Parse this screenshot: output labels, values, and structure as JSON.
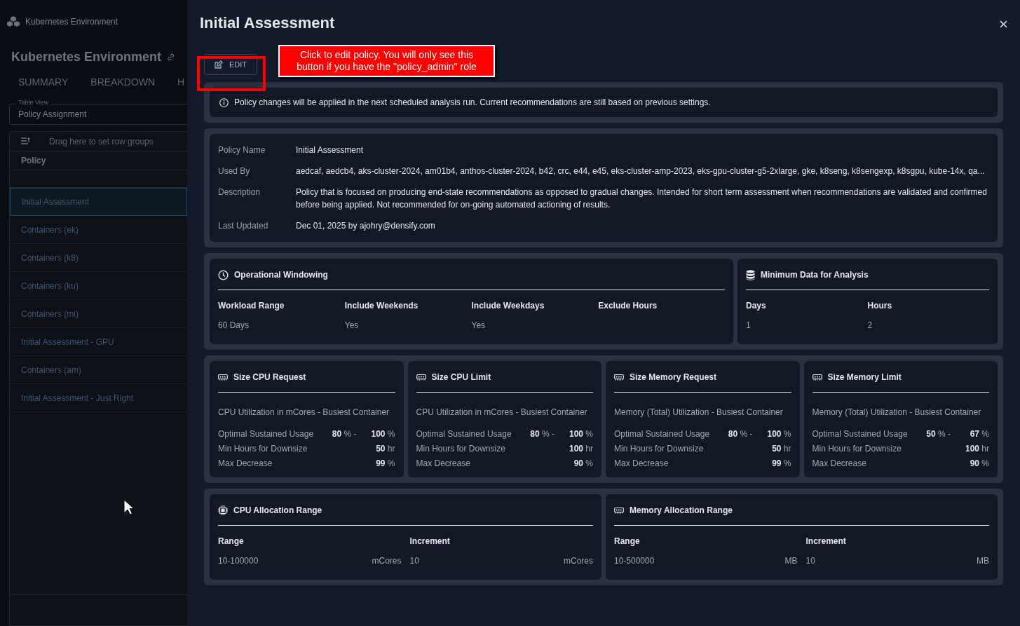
{
  "background_page": {
    "app_title": "Kubernetes Environment",
    "heading": "Kubernetes Environment",
    "tabs": [
      {
        "label": "SUMMARY",
        "selected": false
      },
      {
        "label": "BREAKDOWN",
        "selected": false
      },
      {
        "label": "H",
        "selected": false
      }
    ],
    "table_view": {
      "label": "Table View",
      "value": "Policy Assignment"
    },
    "group_hint": "Drag here to set row groups",
    "column": "Policy",
    "rows": [
      {
        "label": "Initial Assessment",
        "selected": true
      },
      {
        "label": "Containers (ek)",
        "selected": false
      },
      {
        "label": "Containers (k8)",
        "selected": false
      },
      {
        "label": "Containers (ku)",
        "selected": false
      },
      {
        "label": "Containers (mi)",
        "selected": false
      },
      {
        "label": "Initial Assessment - GPU",
        "selected": false
      },
      {
        "label": "Containers (am)",
        "selected": false
      },
      {
        "label": "Initial Assessment - Just Right",
        "selected": false
      }
    ]
  },
  "drawer": {
    "title": "Initial Assessment",
    "edit_button": "EDIT",
    "annotation": "Click to edit policy. You will only see this button if you have the \"policy_admin\" role",
    "notice": "Policy changes will be applied in the next scheduled analysis run. Current recommendations are still based on previous settings.",
    "details": [
      {
        "label": "Policy Name",
        "value": "Initial Assessment"
      },
      {
        "label": "Used By",
        "value": "aedcaf, aedcb4, aks-cluster-2024, am01b4, anthos-cluster-2024, b42, crc, e44, e45, eks-cluster-amp-2023, eks-gpu-cluster-g5-2xlarge, gke, k8seng, k8sengexp, k8sgpu, kube-14x, qa..."
      },
      {
        "label": "Description",
        "value": "Policy that is focused on producing end-state recommendations as opposed to gradual changes. Intended for short term assessment when recommendations are validated and confirmed before being applied. Not recommended for on-going automated actioning of results."
      },
      {
        "label": "Last Updated",
        "value": "Dec 01, 2025 by ajohry@densify.com"
      }
    ],
    "windowing": [
      {
        "title": "Operational Windowing",
        "kind": "schedule",
        "columns": [
          {
            "label": "Workload Range",
            "value": "60 Days"
          },
          {
            "label": "Include Weekends",
            "value": "Yes"
          },
          {
            "label": "Include Weekdays",
            "value": "Yes"
          },
          {
            "label": "Exclude Hours"
          }
        ]
      },
      {
        "title": "Minimum Data for Analysis",
        "kind": "data",
        "columns": [
          {
            "label": "Days",
            "value": "1"
          },
          {
            "label": "Hours",
            "value": "2"
          }
        ]
      }
    ],
    "sizing_cards": [
      {
        "title": "Size CPU Request",
        "metric": "CPU Utilization in mCores - Busiest Container",
        "rows": [
          {
            "kind": "range",
            "label": "Optimal Sustained Usage",
            "low": "80",
            "low_unit": "% -",
            "high": "100",
            "high_unit": "%"
          },
          {
            "kind": "single",
            "label": "Min Hours for Downsize",
            "value": "50",
            "unit": "hr"
          },
          {
            "kind": "single",
            "label": "Max Decrease",
            "value": "99",
            "unit": "%"
          }
        ]
      },
      {
        "title": "Size CPU Limit",
        "metric": "CPU Utilization in mCores - Busiest Container",
        "rows": [
          {
            "kind": "range",
            "label": "Optimal Sustained Usage",
            "low": "80",
            "low_unit": "% -",
            "high": "100",
            "high_unit": "%"
          },
          {
            "kind": "single",
            "label": "Min Hours for Downsize",
            "value": "100",
            "unit": "hr"
          },
          {
            "kind": "single",
            "label": "Max Decrease",
            "value": "90",
            "unit": "%"
          }
        ]
      },
      {
        "title": "Size Memory Request",
        "metric": "Memory (Total) Utilization - Busiest Container",
        "rows": [
          {
            "kind": "range",
            "label": "Optimal Sustained Usage",
            "low": "80",
            "low_unit": "% -",
            "high": "100",
            "high_unit": "%"
          },
          {
            "kind": "single",
            "label": "Min Hours for Downsize",
            "value": "50",
            "unit": "hr"
          },
          {
            "kind": "single",
            "label": "Max Decrease",
            "value": "99",
            "unit": "%"
          }
        ]
      },
      {
        "title": "Size Memory Limit",
        "metric": "Memory (Total) Utilization - Busiest Container",
        "rows": [
          {
            "kind": "range",
            "label": "Optimal Sustained Usage",
            "low": "50",
            "low_unit": "% -",
            "high": "67",
            "high_unit": "%"
          },
          {
            "kind": "single",
            "label": "Min Hours for Downsize",
            "value": "100",
            "unit": "hr"
          },
          {
            "kind": "single",
            "label": "Max Decrease",
            "value": "90",
            "unit": "%"
          }
        ]
      }
    ],
    "allocation": [
      {
        "title": "CPU Allocation Range",
        "kind": "cpu",
        "columns": [
          {
            "label": "Range",
            "value": "10-100000",
            "unit": "mCores"
          },
          {
            "label": "Increment",
            "value": "10",
            "unit": "mCores"
          }
        ]
      },
      {
        "title": "Memory Allocation Range",
        "kind": "memory",
        "columns": [
          {
            "label": "Range",
            "value": "10-500000",
            "unit": "MB"
          },
          {
            "label": "Increment",
            "value": "10",
            "unit": "MB"
          }
        ]
      }
    ]
  }
}
